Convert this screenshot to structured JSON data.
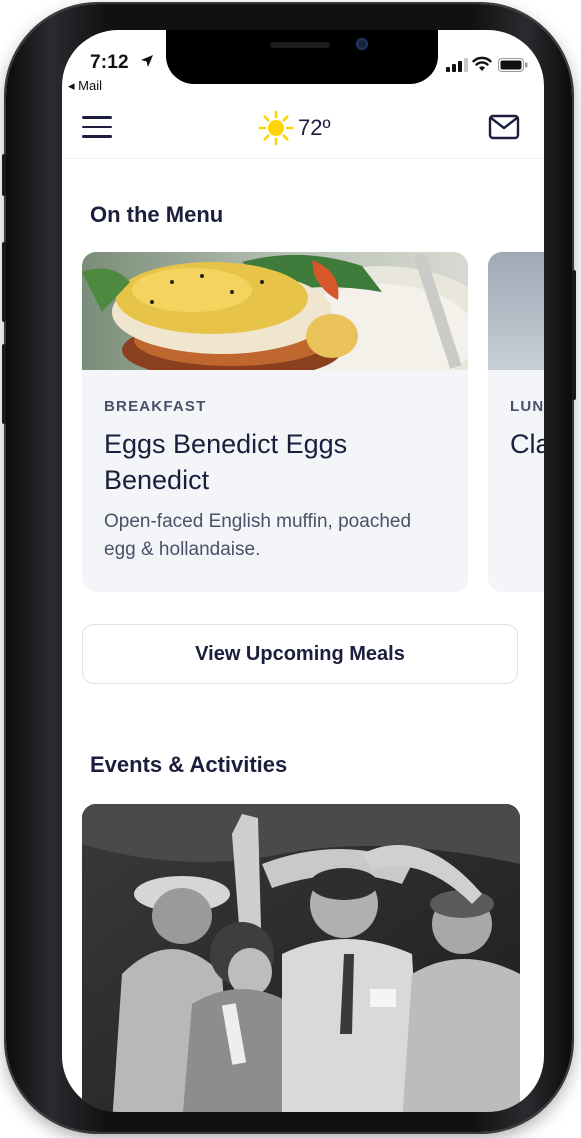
{
  "status_bar": {
    "time": "7:12",
    "back_app": "◂ Mail"
  },
  "header": {
    "temperature": "72º",
    "menu_icon": "hamburger-menu-icon",
    "weather_icon": "sun-icon",
    "mail_icon": "envelope-icon"
  },
  "menu_section": {
    "title": "On the Menu",
    "cards": [
      {
        "category": "BREAKFAST",
        "title": "Eggs Benedict Eggs Benedict",
        "description": "Open-faced English muffin, poached egg & hollandaise."
      },
      {
        "category": "LUN",
        "title": "Cla",
        "description": ""
      }
    ],
    "button_label": "View Upcoming Meals"
  },
  "events_section": {
    "title": "Events & Activities"
  },
  "colors": {
    "text_primary": "#1b1e3c",
    "card_background": "#f4f5f8",
    "sun": "#ffd400"
  }
}
